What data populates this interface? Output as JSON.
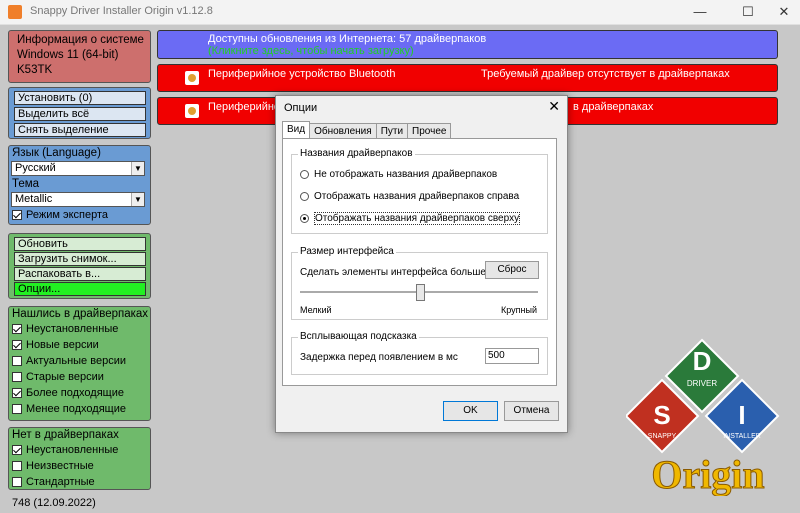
{
  "window": {
    "title": "Snappy Driver Installer Origin v1.12.8",
    "minimize": "—",
    "maximize": "☐",
    "close": "✕"
  },
  "sysinfo": {
    "heading": "Информация о системе",
    "os": "Windows 11 (64-bit)",
    "host": "K53TK"
  },
  "actions": {
    "install": "Установить (0)",
    "select_all": "Выделить всё",
    "deselect": "Снять выделение"
  },
  "language": {
    "label": "Язык (Language)",
    "value": "Русский",
    "theme_label": "Тема",
    "theme_value": "Metallic",
    "expert_mode": "Режим эксперта"
  },
  "tools": {
    "update": "Обновить",
    "load_snapshot": "Загрузить снимок...",
    "extract": "Распаковать в...",
    "options": "Опции..."
  },
  "found": {
    "heading": "Нашлись в драйверпаках",
    "items": [
      {
        "label": "Неустановленные",
        "checked": true
      },
      {
        "label": "Новые версии",
        "checked": true
      },
      {
        "label": "Актуальные версии",
        "checked": false
      },
      {
        "label": "Старые версии",
        "checked": false
      },
      {
        "label": "Более подходящие",
        "checked": true
      },
      {
        "label": "Менее подходящие",
        "checked": false
      }
    ]
  },
  "notfound": {
    "heading": "Нет в драйверпаках",
    "items": [
      {
        "label": "Неустановленные",
        "checked": true
      },
      {
        "label": "Неизвестные",
        "checked": false
      },
      {
        "label": "Стандартные",
        "checked": false
      }
    ]
  },
  "footer_version": "748 (12.09.2022)",
  "updates_bar": {
    "line1": "Доступны обновления из Интернета: 57 драйверпаков",
    "line2": "(Кликните здесь, чтобы начать загрузку)"
  },
  "devices": [
    {
      "name": "Периферийное устройство Bluetooth",
      "status": "Требуемый драйвер отсутствует в драйверпаках"
    },
    {
      "name": "Периферийное",
      "status": "в драйверпаках"
    }
  ],
  "dialog": {
    "title": "Опции",
    "close": "✕",
    "tabs": [
      "Вид",
      "Обновления",
      "Пути",
      "Прочее"
    ],
    "names_group": "Названия драйверпаков",
    "radio": [
      "Не отображать названия драйверпаков",
      "Отображать названия драйверпаков справа",
      "Отображать названия драйверпаков сверху"
    ],
    "radio_selected": 2,
    "size_group": "Размер интерфейса",
    "size_text": "Сделать элементы интерфейса больше или мень",
    "reset": "Сброс",
    "small": "Мелкий",
    "large": "Крупный",
    "tooltip_group": "Всплывающая подсказка",
    "delay_label": "Задержка перед появлением в мс",
    "delay_value": "500",
    "ok": "OK",
    "cancel": "Отмена"
  },
  "logo": {
    "d": "D",
    "s": "S",
    "i": "I",
    "driver": "DRIVER",
    "snappy": "SNAPPY",
    "installer": "INSTALLER",
    "origin": "Origin"
  },
  "colors": {
    "blue_bar": "#6b6bf4",
    "red_bar": "#f10000",
    "green_link": "#22d022",
    "options_button": "#22f022"
  }
}
